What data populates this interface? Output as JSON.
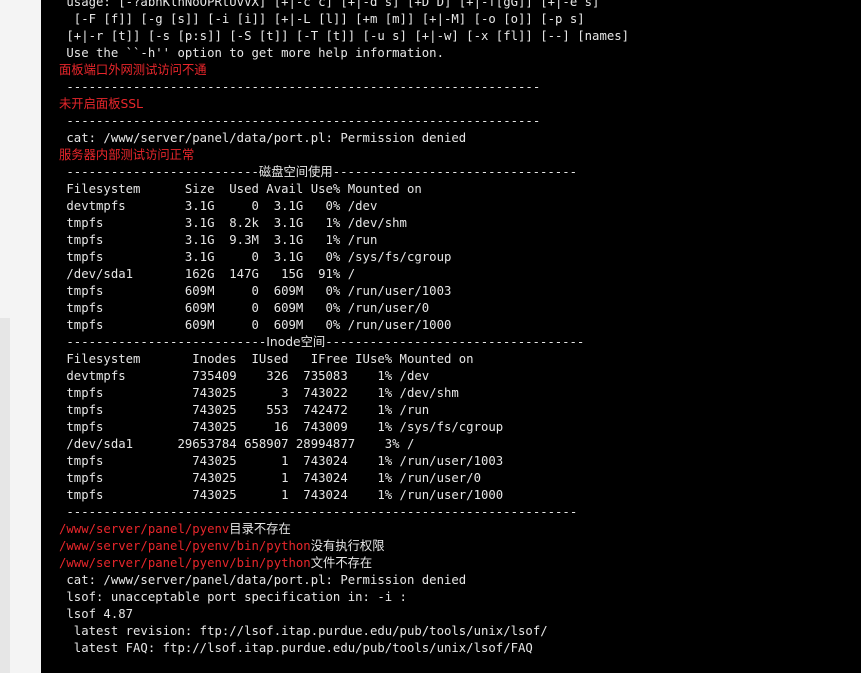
{
  "terminal": {
    "lines": [
      [
        {
          "t": " usage: [-?abhKlnNoOPRtUvVX] [+|-c c] [+|-d s] [+D D] [+|-f[gG]] [+|-e s]"
        }
      ],
      [
        {
          "t": "  [-F [f]] [-g [s]] [-i [i]] [+|-L [l]] [+m [m]] [+|-M] [-o [o]] [-p s]"
        }
      ],
      [
        {
          "t": " [+|-r [t]] [-s [p:s]] [-S [t]] [-T [t]] [-u s] [+|-w] [-x [fl]] [--] [names]"
        }
      ],
      [
        {
          "t": " Use the ``-h'' option to get more help information."
        }
      ],
      [
        {
          "t": "面板端口外网测试访问不通",
          "c": "red cjk"
        }
      ],
      [
        {
          "t": " ----------------------------------------------------------------"
        }
      ],
      [
        {
          "t": "未开启面板SSL",
          "c": "red cjk"
        }
      ],
      [
        {
          "t": " ----------------------------------------------------------------"
        }
      ],
      [
        {
          "t": " cat: /www/server/panel/data/port.pl: Permission denied"
        }
      ],
      [
        {
          "t": "服务器内部测试访问正常",
          "c": "red cjk"
        }
      ],
      [
        {
          "t": " --------------------------"
        },
        {
          "t": "磁盘空间使用",
          "c": "cjk"
        },
        {
          "t": "---------------------------------"
        }
      ],
      [
        {
          "t": " Filesystem      Size  Used Avail Use% Mounted on"
        }
      ],
      [
        {
          "t": " devtmpfs        3.1G     0  3.1G   0% /dev"
        }
      ],
      [
        {
          "t": " tmpfs           3.1G  8.2k  3.1G   1% /dev/shm"
        }
      ],
      [
        {
          "t": " tmpfs           3.1G  9.3M  3.1G   1% /run"
        }
      ],
      [
        {
          "t": " tmpfs           3.1G     0  3.1G   0% /sys/fs/cgroup"
        }
      ],
      [
        {
          "t": " /dev/sda1       162G  147G   15G  91% /"
        }
      ],
      [
        {
          "t": " tmpfs           609M     0  609M   0% /run/user/1003"
        }
      ],
      [
        {
          "t": " tmpfs           609M     0  609M   0% /run/user/0"
        }
      ],
      [
        {
          "t": " tmpfs           609M     0  609M   0% /run/user/1000"
        }
      ],
      [
        {
          "t": " ---------------------------"
        },
        {
          "t": "Inode空间",
          "c": "cjk"
        },
        {
          "t": "-----------------------------------"
        }
      ],
      [
        {
          "t": " Filesystem       Inodes  IUsed   IFree IUse% Mounted on"
        }
      ],
      [
        {
          "t": " devtmpfs         735409    326  735083    1% /dev"
        }
      ],
      [
        {
          "t": " tmpfs            743025      3  743022    1% /dev/shm"
        }
      ],
      [
        {
          "t": " tmpfs            743025    553  742472    1% /run"
        }
      ],
      [
        {
          "t": " tmpfs            743025     16  743009    1% /sys/fs/cgroup"
        }
      ],
      [
        {
          "t": " /dev/sda1      29653784 658907 28994877    3% /"
        }
      ],
      [
        {
          "t": " tmpfs            743025      1  743024    1% /run/user/1003"
        }
      ],
      [
        {
          "t": " tmpfs            743025      1  743024    1% /run/user/0"
        }
      ],
      [
        {
          "t": " tmpfs            743025      1  743024    1% /run/user/1000"
        }
      ],
      [
        {
          "t": " ---------------------------------------------------------------------"
        }
      ],
      [
        {
          "t": "/www/server/panel/pyenv",
          "c": "red"
        },
        {
          "t": "目录不存在",
          "c": "cjk"
        }
      ],
      [
        {
          "t": "/www/server/panel/pyenv/bin/python",
          "c": "red"
        },
        {
          "t": "没有执行权限",
          "c": "cjk"
        }
      ],
      [
        {
          "t": "/www/server/panel/pyenv/bin/python",
          "c": "red"
        },
        {
          "t": "文件不存在",
          "c": "cjk"
        }
      ],
      [
        {
          "t": " cat: /www/server/panel/data/port.pl: Permission denied"
        }
      ],
      [
        {
          "t": " lsof: unacceptable port specification in: -i :"
        }
      ],
      [
        {
          "t": " lsof 4.87"
        }
      ],
      [
        {
          "t": "  latest revision: ftp://lsof.itap.purdue.edu/pub/tools/unix/lsof/"
        }
      ],
      [
        {
          "t": "  latest FAQ: ftp://lsof.itap.purdue.edu/pub/tools/unix/lsof/FAQ"
        }
      ]
    ]
  },
  "colors": {
    "background": "#000000",
    "text": "#e6e6e6",
    "error": "#e8262b"
  }
}
